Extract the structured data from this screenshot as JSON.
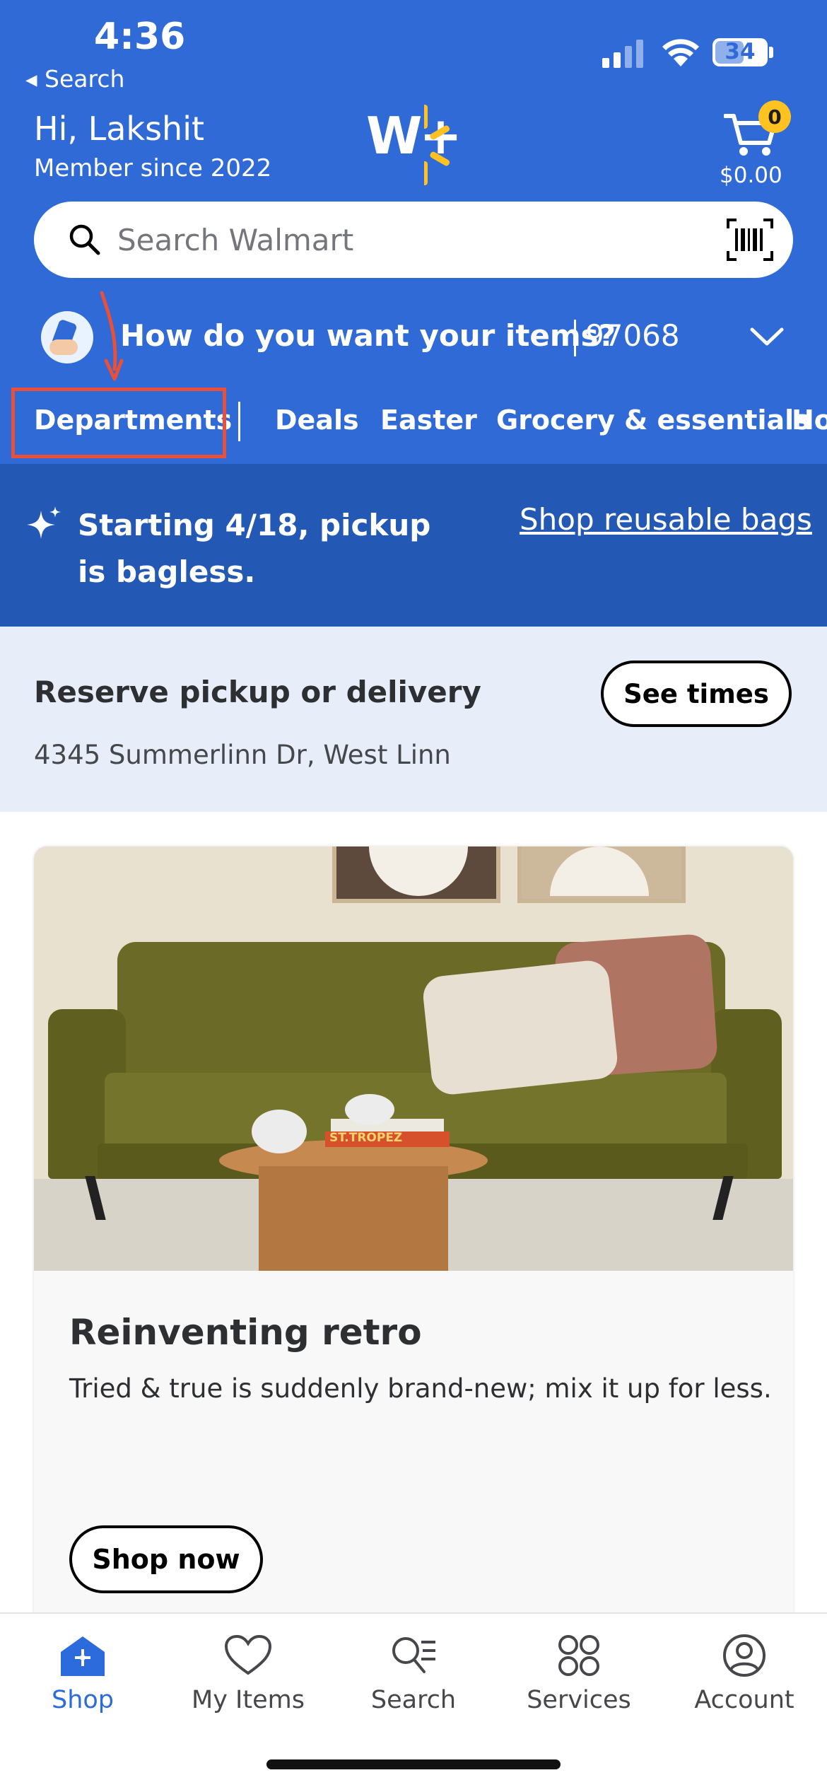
{
  "status_bar": {
    "time": "4:36",
    "back_label": "◂ Search",
    "battery": "34"
  },
  "header": {
    "greeting": "Hi, Lakshit",
    "member_since": "Member since 2022",
    "cart_count": "0",
    "cart_total": "$0.00",
    "logo_text": "W+"
  },
  "search": {
    "placeholder": "Search Walmart"
  },
  "fulfillment": {
    "question": "How do you want your items?",
    "zip": "97068"
  },
  "nav": {
    "items": [
      {
        "label": "Departments"
      },
      {
        "label": "Deals"
      },
      {
        "label": "Easter"
      },
      {
        "label": "Grocery & essentials"
      },
      {
        "label": "Ho"
      }
    ]
  },
  "banner": {
    "message": "Starting 4/18, pickup is bagless.",
    "link": "Shop reusable bags"
  },
  "reserve": {
    "title": "Reserve pickup or delivery",
    "address": "4345 Summerlinn Dr, West Linn",
    "button": "See times"
  },
  "promo_card": {
    "title": "Reinventing retro",
    "description": "Tried & true is suddenly brand-new; mix it up for less.",
    "button": "Shop now",
    "book_text": "ST.TROPEZ"
  },
  "tab_bar": {
    "tabs": [
      {
        "label": "Shop",
        "icon": "shop-icon",
        "active": true
      },
      {
        "label": "My Items",
        "icon": "heart-icon",
        "active": false
      },
      {
        "label": "Search",
        "icon": "search-list-icon",
        "active": false
      },
      {
        "label": "Services",
        "icon": "services-icon",
        "active": false
      },
      {
        "label": "Account",
        "icon": "account-icon",
        "active": false
      }
    ]
  },
  "colors": {
    "header_blue": "#2f6ad6",
    "banner_blue": "#2458b5",
    "accent_yellow": "#ffc220",
    "highlight_red": "#e8503a",
    "active_tab_blue": "#2b6bdc"
  }
}
